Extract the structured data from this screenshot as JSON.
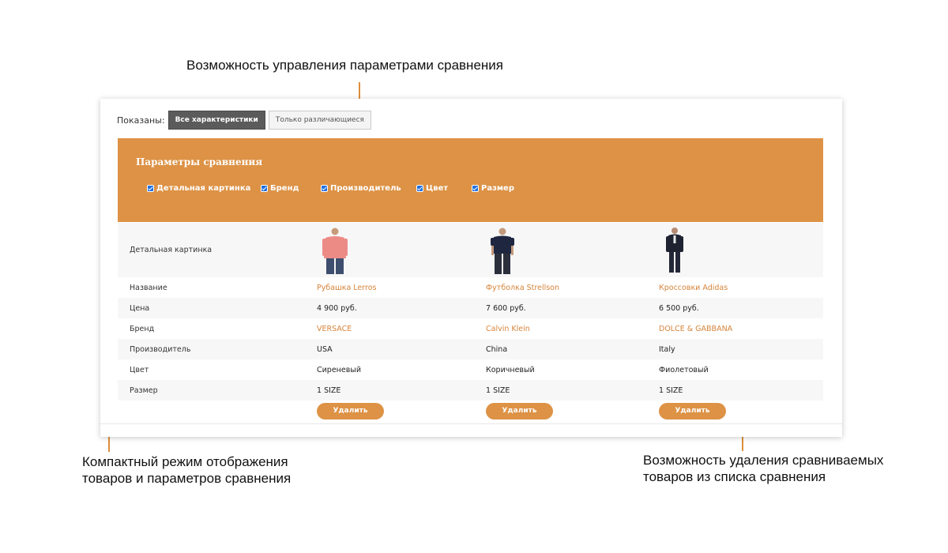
{
  "annotations": {
    "top": "Возможность управления параметрами сравнения",
    "left": "Компактный режим отображения товаров и параметров сравнения",
    "right": "Возможность удаления сравниваемых товаров из списка сравнения",
    "accent_color": "#dd8f3c"
  },
  "toolbar": {
    "shown_label": "Показаны:",
    "all_label": "Все характеристики",
    "diff_label": "Только различающиеся"
  },
  "params": {
    "title": "Параметры сравнения",
    "color": "#dd9245",
    "items": [
      {
        "label": "Детальная картинка",
        "checked": true
      },
      {
        "label": "Бренд",
        "checked": true
      },
      {
        "label": "Производитель",
        "checked": true
      },
      {
        "label": "Цвет",
        "checked": true
      },
      {
        "label": "Размер",
        "checked": true
      }
    ]
  },
  "compare": {
    "rows": {
      "picture": "Детальная картинка",
      "name": "Название",
      "price": "Цена",
      "brand": "Бренд",
      "maker": "Производитель",
      "color": "Цвет",
      "size": "Размер"
    },
    "products": [
      {
        "image": "pink-shirt-icon",
        "name": "Рубашка Lerros",
        "price": "4 900 руб.",
        "brand": "VERSACE",
        "maker": "USA",
        "color": "Сиреневый",
        "size": "1 SIZE"
      },
      {
        "image": "navy-tshirt-icon",
        "name": "Футболка Strellson",
        "price": "7 600 руб.",
        "brand": "Calvin Klein",
        "maker": "China",
        "color": "Коричневый",
        "size": "1 SIZE"
      },
      {
        "image": "dark-suit-icon",
        "name": "Кроссовки Adidas",
        "price": "6 500 руб.",
        "brand": "DOLCE & GABBANA",
        "maker": "Italy",
        "color": "Фиолетовый",
        "size": "1 SIZE"
      }
    ],
    "delete_label": "Удалить"
  }
}
